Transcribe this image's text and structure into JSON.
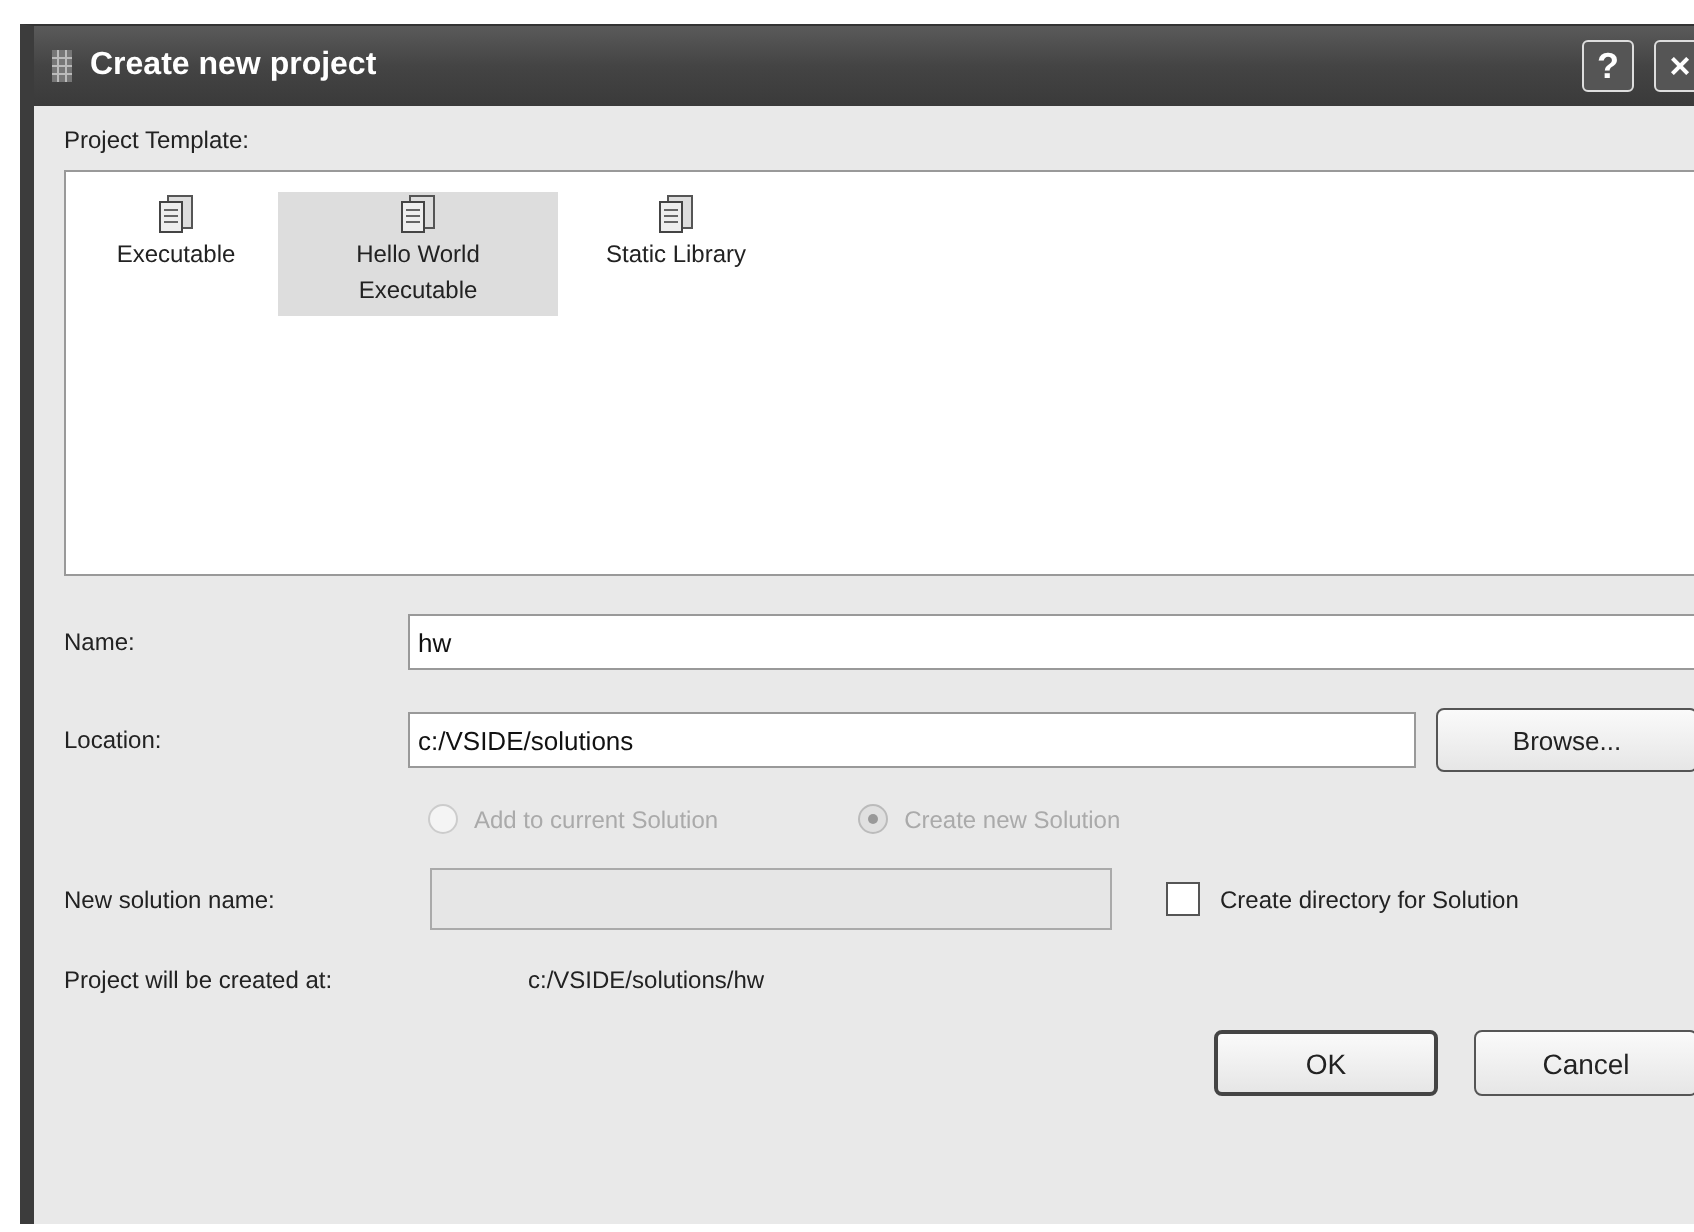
{
  "window": {
    "title": "Create new project",
    "help_button": "?",
    "close_button": "×"
  },
  "template_list": {
    "label": "Project Template:",
    "items": [
      {
        "label": "Executable",
        "selected": false
      },
      {
        "label": "Hello World Executable",
        "selected": true
      },
      {
        "label": "Static Library",
        "selected": false
      }
    ]
  },
  "name": {
    "label": "Name:",
    "value": "hw"
  },
  "location": {
    "label": "Location:",
    "value": "c:/VSIDE/solutions",
    "browse_button": "Browse..."
  },
  "solution_options": [
    {
      "label": "Add to current Solution",
      "selected": false,
      "disabled": true
    },
    {
      "label": "Create new Solution",
      "selected": true,
      "disabled": true
    }
  ],
  "new_solution_name": {
    "label": "New solution name:",
    "disabled": true
  },
  "create_directory": {
    "label": "Create directory for Solution",
    "checked": false
  },
  "result": {
    "label": "Project will be created at:",
    "value": "c:/VSIDE/solutions/hw"
  },
  "buttons": [
    "OK",
    "Cancel"
  ]
}
